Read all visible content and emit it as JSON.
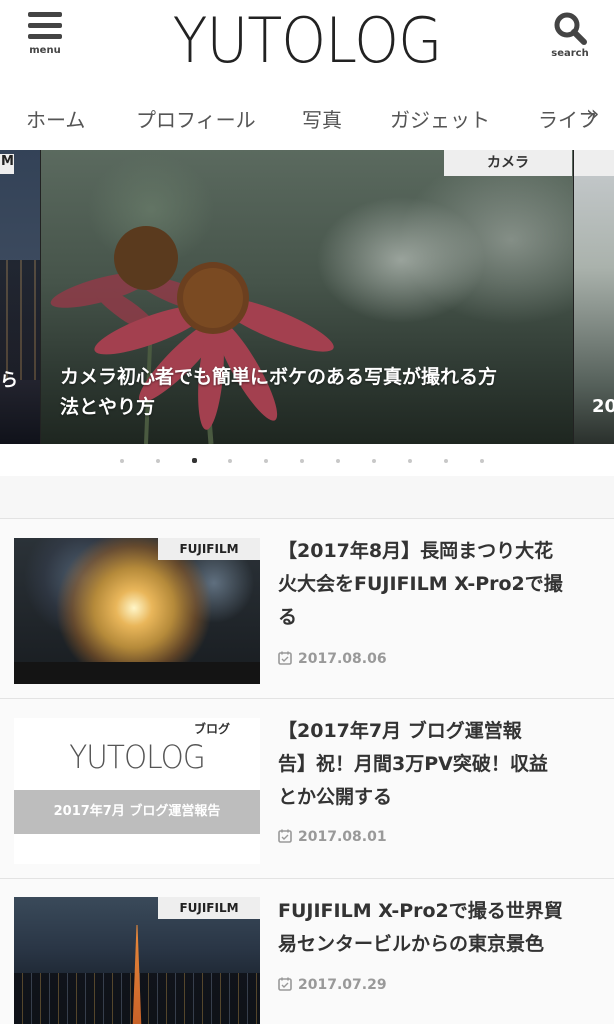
{
  "header": {
    "menu_label": "menu",
    "logo": "YUTOLOG",
    "search_label": "search"
  },
  "nav": {
    "items": [
      "ホーム",
      "プロフィール",
      "写真",
      "ガジェット",
      "ライフ"
    ],
    "more": "»"
  },
  "carousel": {
    "left_label": "M",
    "left_title": "ら",
    "main": {
      "category": "カメラ",
      "title_line1": "カメラ初心者でも簡単にボケのある写真が撮れる方",
      "title_line2": "法とやり方"
    },
    "right_title": "20",
    "dot_count": 11,
    "active_dot": 3
  },
  "articles": [
    {
      "category": "FUJIFILM",
      "title_lines": [
        "【2017年8月】長岡まつり大花",
        "火大会をFUJIFILM X-Pro2で撮",
        "る"
      ],
      "date": "2017.08.06"
    },
    {
      "category": "ブログ",
      "thumb_logo": "YUTOLOG",
      "thumb_bar": "2017年7月 ブログ運営報告",
      "title_lines": [
        "【2017年7月 ブログ運営報",
        "告】祝！月間3万PV突破！収益",
        "とか公開する"
      ],
      "date": "2017.08.01"
    },
    {
      "category": "FUJIFILM",
      "title_lines": [
        "FUJIFILM X-Pro2で撮る世界貿",
        "易センタービルからの東京景色"
      ],
      "date": "2017.07.29"
    }
  ]
}
